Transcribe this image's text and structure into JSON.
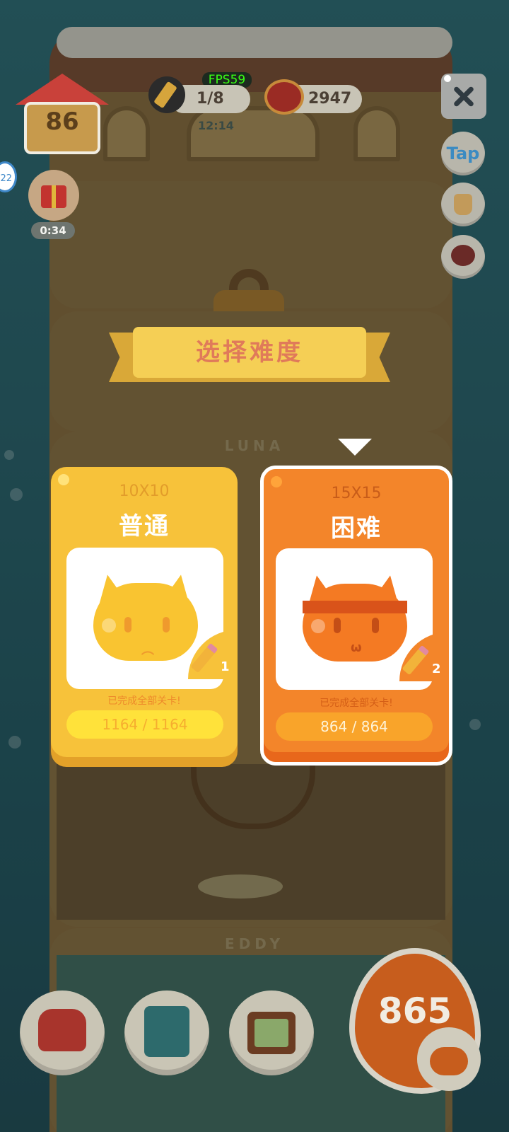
{
  "hud": {
    "house_level": "86",
    "fps": "FPS59",
    "pencils": "1/8",
    "timer": "12:14",
    "cans": "2947",
    "gift_timer": "0:34",
    "side_badge": "22"
  },
  "side_buttons": {
    "tap_label": "Tap"
  },
  "floors": {
    "luna": "LUNA",
    "eddy": "EDDY"
  },
  "modal": {
    "title": "选择难度",
    "cards": [
      {
        "size": "10X10",
        "name": "普通",
        "pencils": "1",
        "status": "已完成全部关卡!",
        "progress": "1164 / 1164",
        "color": "#f7c23a"
      },
      {
        "size": "15X15",
        "name": "困难",
        "pencils": "2",
        "status": "已完成全部关卡!",
        "progress": "864 / 864",
        "color": "#f3852a"
      }
    ]
  },
  "bottom": {
    "play_count": "865"
  },
  "colors": {
    "normal": "#f7c23a",
    "hard": "#f3852a",
    "banner": "#f5cf55",
    "banner_text": "#e07a5a"
  },
  "icons": [
    "house-icon",
    "pencil-icon",
    "cat-food-can-icon",
    "gift-icon",
    "close-icon",
    "brush-icon",
    "stamp-icon",
    "lock-icon",
    "armchair-icon",
    "book-icon",
    "picture-frame-icon",
    "cat-icon"
  ]
}
